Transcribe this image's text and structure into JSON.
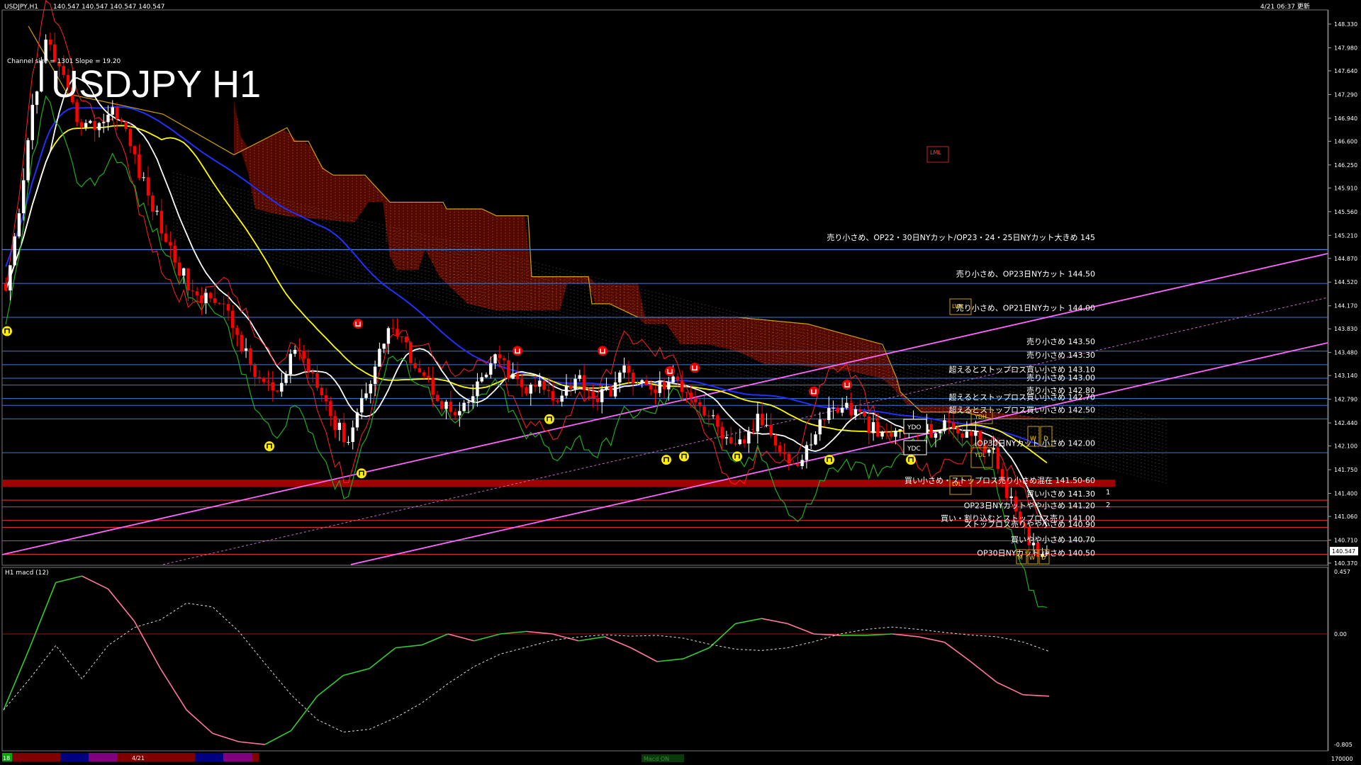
{
  "window": {
    "title": "USDJPY,H1",
    "ohlc": "140.547 140.547 140.547 140.547",
    "timestamp": "4/21 06:37 更新"
  },
  "overlay": {
    "title": "USDJPY H1",
    "channel_info": "Channel size = 1301 Slope = 19.20"
  },
  "price_axis": {
    "labels": [
      "148.330",
      "147.980",
      "147.640",
      "147.290",
      "146.940",
      "146.600",
      "146.250",
      "145.910",
      "145.560",
      "145.210",
      "144.870",
      "144.520",
      "144.170",
      "143.830",
      "143.480",
      "143.140",
      "142.790",
      "142.440",
      "142.100",
      "141.750",
      "141.400",
      "141.060",
      "140.710",
      "140.370"
    ],
    "current_price": "140.547"
  },
  "level_labels": [
    "売り小さめ、OP22・30日NYカット/OP23・24・25日NYカット大きめ 145",
    "売り小さめ、OP23日NYカット 144.50",
    "売り小さめ、OP21日NYカット 144.00",
    "売り小さめ 143.50",
    "売り小さめ 143.30",
    "超えるとストップロス買い小さめ 143.10",
    "売り小さめ 143.00",
    "売り小さめ 142.80",
    "超えるとストップロス買い小さめ 142.70",
    "超えるとストップロス買い小さめ 142.50",
    "OP30日NYカット 小さめ 142.00",
    "買い小さめ・ストップロス売り小さめ混在 141.50-60",
    "買い小さめ 141.30",
    "OP23日NYカットやや小さめ 141.20",
    "買い・割り込むとストップロス売り 141.00",
    "ストップロス売りやや小さめ 140.90",
    "買いやや小さめ 140.70",
    "OP30日NYカット 小さめ 140.50"
  ],
  "markers": {
    "lml": "LML",
    "lvh": "LVH",
    "lvl": "LVL",
    "ydo": "YDO",
    "ydc": "YDC",
    "ydh": "YDH",
    "ydl": "YDL",
    "w": "W",
    "d": "D",
    "m": "M",
    "n1": "1",
    "n2": "2"
  },
  "macd": {
    "label": "H1  macd (12)",
    "axis_labels": [
      "0.457",
      "0.00",
      "-0.805"
    ]
  },
  "time_bar": {
    "date_label": "4/21",
    "left_label": "18",
    "right_label": "170000",
    "status_label": "Macd ON"
  },
  "colors": {
    "background": "#000000",
    "bull_candle": "#ffffff",
    "bear_candle": "#ff0000",
    "cloud": "#ff4000",
    "level_blue": "#3a7bd5",
    "level_red": "#ff3333",
    "ma_yellow": "#ffff00",
    "ma_blue": "#2030ff",
    "ma_white": "#ffffff",
    "channel_pink": "#ff66ff",
    "macd_green": "#33cc33",
    "macd_pink": "#ff7799"
  },
  "chart_data": {
    "type": "candlestick",
    "symbol": "USDJPY",
    "timeframe": "H1",
    "ylim": [
      140.37,
      148.33
    ],
    "levels": [
      145.0,
      144.5,
      144.0,
      143.5,
      143.3,
      143.1,
      143.0,
      142.8,
      142.7,
      142.5,
      142.0,
      141.55,
      141.3,
      141.2,
      141.0,
      140.9,
      140.7,
      140.5
    ],
    "close_path": [
      144.3,
      145.5,
      147.2,
      148.1,
      147.6,
      147.0,
      146.8,
      146.9,
      147.1,
      146.6,
      146.0,
      145.5,
      145.0,
      144.6,
      144.2,
      144.4,
      144.1,
      143.7,
      143.2,
      143.0,
      142.8,
      143.6,
      143.3,
      143.0,
      142.4,
      142.2,
      142.8,
      143.3,
      143.9,
      143.6,
      143.3,
      143.0,
      142.7,
      142.5,
      142.8,
      143.2,
      143.4,
      143.1,
      142.9,
      143.0,
      142.8,
      143.0,
      143.1,
      142.8,
      142.9,
      143.2,
      143.1,
      142.9,
      143.0,
      143.05,
      142.9,
      142.6,
      142.4,
      142.0,
      142.2,
      142.5,
      142.3,
      141.9,
      141.8,
      142.3,
      142.6,
      142.7,
      142.6,
      142.4,
      142.2,
      142.3,
      142.4,
      142.3,
      142.35,
      142.4,
      142.3,
      142.2,
      142.0,
      141.5,
      140.9,
      140.6,
      140.55
    ],
    "macd_values": [
      -0.55,
      -0.1,
      0.4,
      0.45,
      0.35,
      0.1,
      -0.25,
      -0.55,
      -0.72,
      -0.78,
      -0.8,
      -0.7,
      -0.45,
      -0.3,
      -0.25,
      -0.1,
      -0.08,
      0.0,
      -0.05,
      0.0,
      0.02,
      0.0,
      -0.05,
      -0.02,
      -0.1,
      -0.2,
      -0.18,
      -0.1,
      0.08,
      0.12,
      0.08,
      0.0,
      -0.01,
      -0.01,
      0.0,
      -0.02,
      -0.06,
      -0.2,
      -0.35,
      -0.44,
      -0.45
    ]
  }
}
